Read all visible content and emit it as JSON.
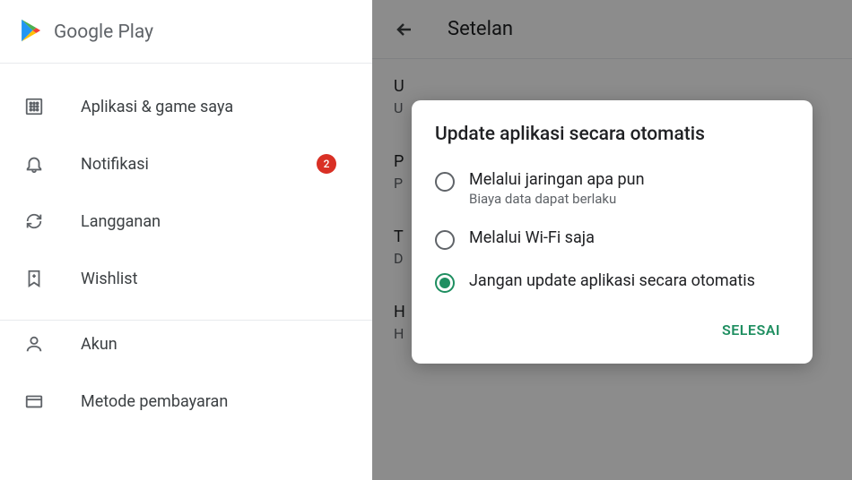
{
  "drawer": {
    "brand": "Google Play",
    "items": [
      {
        "label": "Aplikasi & game saya",
        "badge": null
      },
      {
        "label": "Notifikasi",
        "badge": "2"
      },
      {
        "label": "Langganan",
        "badge": null
      },
      {
        "label": "Wishlist",
        "badge": null
      },
      {
        "label": "Akun",
        "badge": null
      },
      {
        "label": "Metode pembayaran",
        "badge": null
      }
    ]
  },
  "settings": {
    "header_title": "Setelan",
    "rows": [
      {
        "title": "U",
        "sub": "U"
      },
      {
        "title": "P",
        "sub": "P"
      },
      {
        "title": "T",
        "sub": "D"
      },
      {
        "title": "H",
        "sub": "H"
      }
    ]
  },
  "dialog": {
    "title": "Update aplikasi secara otomatis",
    "options": [
      {
        "label": "Melalui jaringan apa pun",
        "sub": "Biaya data dapat berlaku",
        "selected": false
      },
      {
        "label": "Melalui Wi-Fi saja",
        "sub": "",
        "selected": false
      },
      {
        "label": "Jangan update aplikasi secara otomatis",
        "sub": "",
        "selected": true
      }
    ],
    "done_label": "SELESAI"
  }
}
